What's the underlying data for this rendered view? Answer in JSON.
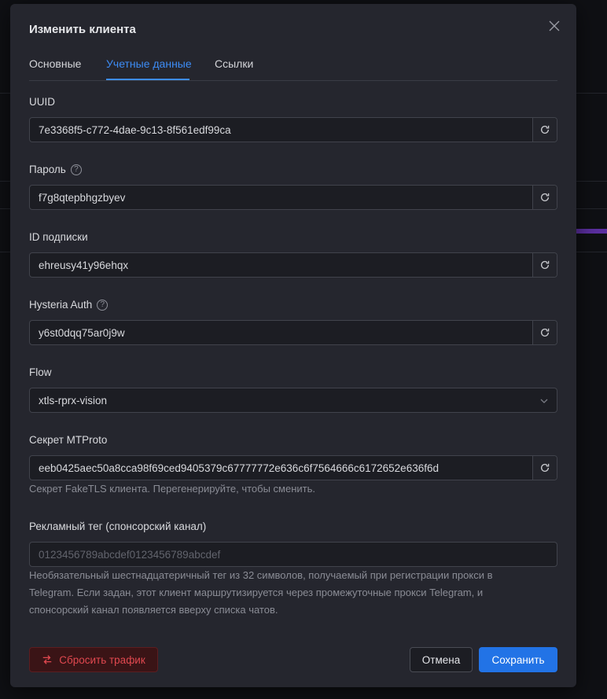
{
  "dialog": {
    "title": "Изменить клиента"
  },
  "tabs": [
    {
      "label": "Основные",
      "active": false
    },
    {
      "label": "Учетные данные",
      "active": true
    },
    {
      "label": "Ссылки",
      "active": false
    }
  ],
  "fields": {
    "uuid": {
      "label": "UUID",
      "value": "7e3368f5-c772-4dae-9c13-8f561edf99ca"
    },
    "password": {
      "label": "Пароль",
      "value": "f7g8qtepbhgzbyev"
    },
    "subscription_id": {
      "label": "ID подписки",
      "value": "ehreusy41y96ehqx"
    },
    "hysteria_auth": {
      "label": "Hysteria Auth",
      "value": "y6st0dqq75ar0j9w"
    },
    "flow": {
      "label": "Flow",
      "value": "xtls-rprx-vision"
    },
    "mtproto_secret": {
      "label": "Секрет MTProto",
      "value": "eeb0425aec50a8cca98f69ced9405379c67777772e636c6f7564666c6172652e636f6d",
      "hint": "Секрет FakeTLS клиента. Перегенерируйте, чтобы сменить."
    },
    "ad_tag": {
      "label": "Рекламный тег (спонсорский канал)",
      "placeholder": "0123456789abcdef0123456789abcdef",
      "hint_line1": "Необязательный шестнадцатеричный тег из 32 символов, получаемый при регистрации прокси в",
      "hint_line2": "Telegram. Если задан, этот клиент маршрутизируется через промежуточные прокси Telegram, и",
      "hint_line3": "спонсорский канал появляется вверху списка чатов."
    }
  },
  "buttons": {
    "reset_traffic": "Сбросить трафик",
    "cancel": "Отмена",
    "save": "Сохранить"
  },
  "icons": {
    "help": "?",
    "close": "close-icon",
    "regenerate": "refresh-icon",
    "reset": "swap-arrows-icon",
    "select": "chevron-down-icon"
  },
  "colors": {
    "accent": "#3d8cf5",
    "primary_button": "#2273e6",
    "danger": "#e0484f",
    "modal_bg": "#25262e"
  }
}
